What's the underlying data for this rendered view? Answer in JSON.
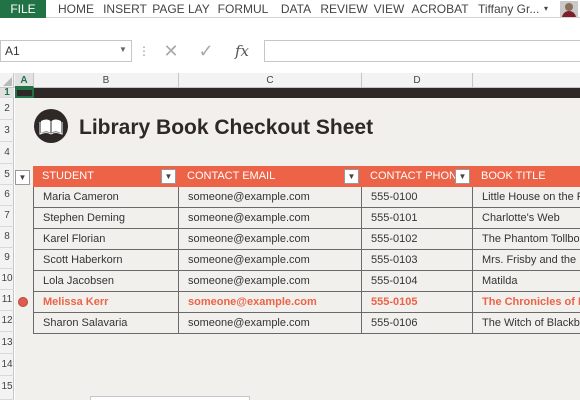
{
  "ribbon": {
    "file_label": "FILE",
    "tabs": [
      "HOME",
      "INSERT",
      "PAGE LAY",
      "FORMUL",
      "DATA",
      "REVIEW",
      "VIEW",
      "ACROBAT"
    ],
    "user_name": "Tiffany Gr...",
    "accent_color": "#217346"
  },
  "formula_bar": {
    "name_box_value": "A1",
    "fx_label": "fx",
    "formula_value": ""
  },
  "grid": {
    "columns": [
      "A",
      "B",
      "C",
      "D"
    ],
    "selected_column": "A",
    "rows": [
      "1",
      "2",
      "3",
      "4",
      "5",
      "6",
      "7",
      "8",
      "9",
      "10",
      "11",
      "12",
      "13",
      "14",
      "15"
    ]
  },
  "sheet": {
    "title": "Library Book Checkout Sheet",
    "icon": "open-book-icon",
    "header_color": "#ec6348",
    "band_color": "#2e2927"
  },
  "table": {
    "headers": [
      "STUDENT",
      "CONTACT EMAIL",
      "CONTACT PHONE",
      "BOOK TITLE"
    ],
    "rows": [
      [
        "Maria Cameron",
        "someone@example.com",
        "555-0100",
        "Little House on the Prairie"
      ],
      [
        "Stephen Deming",
        "someone@example.com",
        "555-0101",
        "Charlotte's Web"
      ],
      [
        "Karel Florian",
        "someone@example.com",
        "555-0102",
        "The Phantom Tollbooth"
      ],
      [
        "Scott Haberkorn",
        "someone@example.com",
        "555-0103",
        "Mrs. Frisby and the Rats of NIMH"
      ],
      [
        "Lola Jacobsen",
        "someone@example.com",
        "555-0104",
        "Matilda"
      ],
      [
        "Melissa Kerr",
        "someone@example.com",
        "555-0105",
        "The Chronicles of Narnia"
      ],
      [
        "Sharon Salavaria",
        "someone@example.com",
        "555-0106",
        "The Witch of Blackbird Pond"
      ]
    ],
    "highlighted_row": 5
  }
}
